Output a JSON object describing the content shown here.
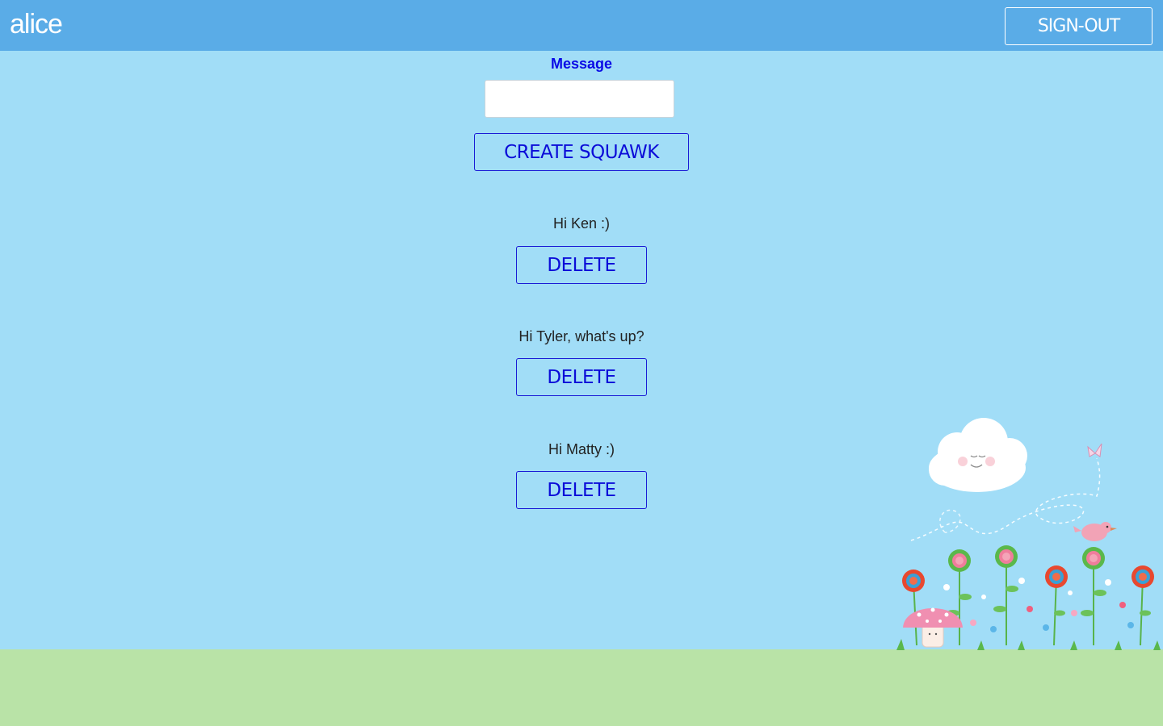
{
  "header": {
    "brand": "alice",
    "signout_label": "SIGN-OUT"
  },
  "composer": {
    "label": "Message",
    "input_value": "",
    "create_label": "CREATE SQUAWK"
  },
  "squawks": [
    {
      "text": "Hi Ken :)",
      "delete_label": "DELETE"
    },
    {
      "text": "Hi Tyler, what's up?",
      "delete_label": "DELETE"
    },
    {
      "text": "Hi Matty :)",
      "delete_label": "DELETE"
    }
  ],
  "decoration": {
    "icons": [
      "cloud-icon",
      "butterfly-icon",
      "bird-icon",
      "mushroom-icon",
      "flower-icon"
    ]
  },
  "colors": {
    "topbar": "#5aace7",
    "sky": "#a1ddf7",
    "grass": "#b9e3a7",
    "accent": "#0b0bd8"
  }
}
